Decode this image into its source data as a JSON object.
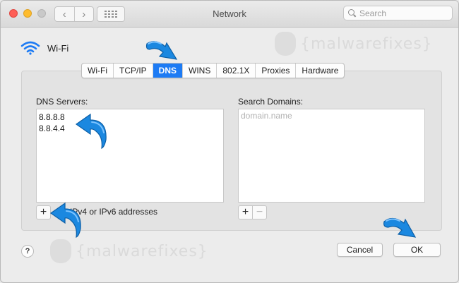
{
  "window": {
    "title": "Network",
    "search_placeholder": "Search",
    "nav_back": "‹",
    "nav_forward": "›"
  },
  "interface": {
    "name": "Wi-Fi",
    "icon": "wifi-icon"
  },
  "tabs": [
    {
      "label": "Wi-Fi",
      "active": false
    },
    {
      "label": "TCP/IP",
      "active": false
    },
    {
      "label": "DNS",
      "active": true
    },
    {
      "label": "WINS",
      "active": false
    },
    {
      "label": "802.1X",
      "active": false
    },
    {
      "label": "Proxies",
      "active": false
    },
    {
      "label": "Hardware",
      "active": false
    }
  ],
  "dns": {
    "label": "DNS Servers:",
    "servers": [
      "8.8.8.8",
      "8.8.4.4"
    ],
    "add_label": "+",
    "hint": "IPv4 or IPv6 addresses"
  },
  "search_domains": {
    "label": "Search Domains:",
    "placeholder": "domain.name",
    "add_label": "+",
    "remove_label": "−"
  },
  "buttons": {
    "help": "?",
    "cancel": "Cancel",
    "ok": "OK"
  },
  "watermark": "{malwarefixes}",
  "colors": {
    "accent": "#1d7bf4",
    "arrow": "#1b88e0"
  }
}
